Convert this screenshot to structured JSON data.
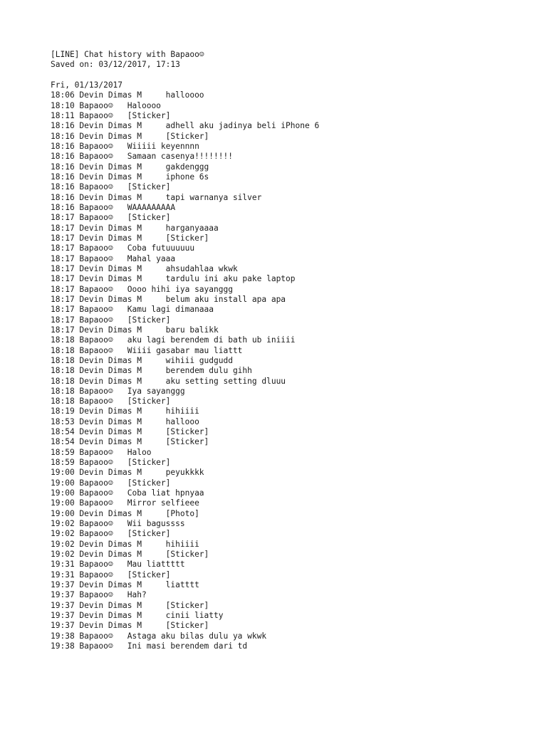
{
  "document": {
    "kind": "plain-text-chat-log",
    "header": {
      "title_line": "[LINE] Chat history with Bapaoo☺",
      "saved_on_line": "Saved on: 03/12/2017, 17:13"
    },
    "date_heading": "Fri, 01/13/2017",
    "participants": {
      "self": "Devin Dimas M",
      "other": "Bapaoo☺"
    },
    "sticker_label": "[Sticker]",
    "photo_label": "[Photo]",
    "messages": [
      {
        "time": "18:06",
        "sender": "Devin Dimas M",
        "text": "halloooo"
      },
      {
        "time": "18:10",
        "sender": "Bapaoo☺",
        "text": "Haloooo"
      },
      {
        "time": "18:11",
        "sender": "Bapaoo☺",
        "text": "[Sticker]"
      },
      {
        "time": "18:16",
        "sender": "Devin Dimas M",
        "text": "adhell aku jadinya beli iPhone 6"
      },
      {
        "time": "18:16",
        "sender": "Devin Dimas M",
        "text": "[Sticker]"
      },
      {
        "time": "18:16",
        "sender": "Bapaoo☺",
        "text": "Wiiiii keyennnn"
      },
      {
        "time": "18:16",
        "sender": "Bapaoo☺",
        "text": "Samaan casenya!!!!!!!!"
      },
      {
        "time": "18:16",
        "sender": "Devin Dimas M",
        "text": "gakdenggg"
      },
      {
        "time": "18:16",
        "sender": "Devin Dimas M",
        "text": "iphone 6s"
      },
      {
        "time": "18:16",
        "sender": "Bapaoo☺",
        "text": "[Sticker]"
      },
      {
        "time": "18:16",
        "sender": "Devin Dimas M",
        "text": "tapi warnanya silver"
      },
      {
        "time": "18:16",
        "sender": "Bapaoo☺",
        "text": "WAAAAAAAAA"
      },
      {
        "time": "18:17",
        "sender": "Bapaoo☺",
        "text": "[Sticker]"
      },
      {
        "time": "18:17",
        "sender": "Devin Dimas M",
        "text": "harganyaaaa"
      },
      {
        "time": "18:17",
        "sender": "Devin Dimas M",
        "text": "[Sticker]"
      },
      {
        "time": "18:17",
        "sender": "Bapaoo☺",
        "text": "Coba futuuuuuu"
      },
      {
        "time": "18:17",
        "sender": "Bapaoo☺",
        "text": "Mahal yaaa"
      },
      {
        "time": "18:17",
        "sender": "Devin Dimas M",
        "text": "ahsudahlaa wkwk"
      },
      {
        "time": "18:17",
        "sender": "Devin Dimas M",
        "text": "tardulu ini aku pake laptop"
      },
      {
        "time": "18:17",
        "sender": "Bapaoo☺",
        "text": "Oooo hihi iya sayanggg"
      },
      {
        "time": "18:17",
        "sender": "Devin Dimas M",
        "text": "belum aku install apa apa"
      },
      {
        "time": "18:17",
        "sender": "Bapaoo☺",
        "text": "Kamu lagi dimanaaa"
      },
      {
        "time": "18:17",
        "sender": "Bapaoo☺",
        "text": "[Sticker]"
      },
      {
        "time": "18:17",
        "sender": "Devin Dimas M",
        "text": "baru balikk"
      },
      {
        "time": "18:18",
        "sender": "Bapaoo☺",
        "text": "aku lagi berendem di bath ub iniiii"
      },
      {
        "time": "18:18",
        "sender": "Bapaoo☺",
        "text": "Wiiii gasabar mau liattt"
      },
      {
        "time": "18:18",
        "sender": "Devin Dimas M",
        "text": "wihiii gudgudd"
      },
      {
        "time": "18:18",
        "sender": "Devin Dimas M",
        "text": "berendem dulu gihh"
      },
      {
        "time": "18:18",
        "sender": "Devin Dimas M",
        "text": "aku setting setting dluuu"
      },
      {
        "time": "18:18",
        "sender": "Bapaoo☺",
        "text": "Iya sayanggg"
      },
      {
        "time": "18:18",
        "sender": "Bapaoo☺",
        "text": "[Sticker]"
      },
      {
        "time": "18:19",
        "sender": "Devin Dimas M",
        "text": "hihiiii"
      },
      {
        "time": "18:53",
        "sender": "Devin Dimas M",
        "text": "hallooo"
      },
      {
        "time": "18:54",
        "sender": "Devin Dimas M",
        "text": "[Sticker]"
      },
      {
        "time": "18:54",
        "sender": "Devin Dimas M",
        "text": "[Sticker]"
      },
      {
        "time": "18:59",
        "sender": "Bapaoo☺",
        "text": "Haloo"
      },
      {
        "time": "18:59",
        "sender": "Bapaoo☺",
        "text": "[Sticker]"
      },
      {
        "time": "19:00",
        "sender": "Devin Dimas M",
        "text": "peyukkkk"
      },
      {
        "time": "19:00",
        "sender": "Bapaoo☺",
        "text": "[Sticker]"
      },
      {
        "time": "19:00",
        "sender": "Bapaoo☺",
        "text": "Coba liat hpnyaa"
      },
      {
        "time": "19:00",
        "sender": "Bapaoo☺",
        "text": "Mirror selfieee"
      },
      {
        "time": "19:00",
        "sender": "Devin Dimas M",
        "text": "[Photo]"
      },
      {
        "time": "19:02",
        "sender": "Bapaoo☺",
        "text": "Wii bagussss"
      },
      {
        "time": "19:02",
        "sender": "Bapaoo☺",
        "text": "[Sticker]"
      },
      {
        "time": "19:02",
        "sender": "Devin Dimas M",
        "text": "hihiiii"
      },
      {
        "time": "19:02",
        "sender": "Devin Dimas M",
        "text": "[Sticker]"
      },
      {
        "time": "19:31",
        "sender": "Bapaoo☺",
        "text": "Mau liattttt"
      },
      {
        "time": "19:31",
        "sender": "Bapaoo☺",
        "text": "[Sticker]"
      },
      {
        "time": "19:37",
        "sender": "Devin Dimas M",
        "text": "liatttt"
      },
      {
        "time": "19:37",
        "sender": "Bapaoo☺",
        "text": "Hah?"
      },
      {
        "time": "19:37",
        "sender": "Devin Dimas M",
        "text": "[Sticker]"
      },
      {
        "time": "19:37",
        "sender": "Devin Dimas M",
        "text": "cinii liatty"
      },
      {
        "time": "19:37",
        "sender": "Devin Dimas M",
        "text": "[Sticker]"
      },
      {
        "time": "19:38",
        "sender": "Bapaoo☺",
        "text": "Astaga aku bilas dulu ya wkwk"
      },
      {
        "time": "19:38",
        "sender": "Bapaoo☺",
        "text": "Ini masi berendem dari td"
      }
    ]
  }
}
